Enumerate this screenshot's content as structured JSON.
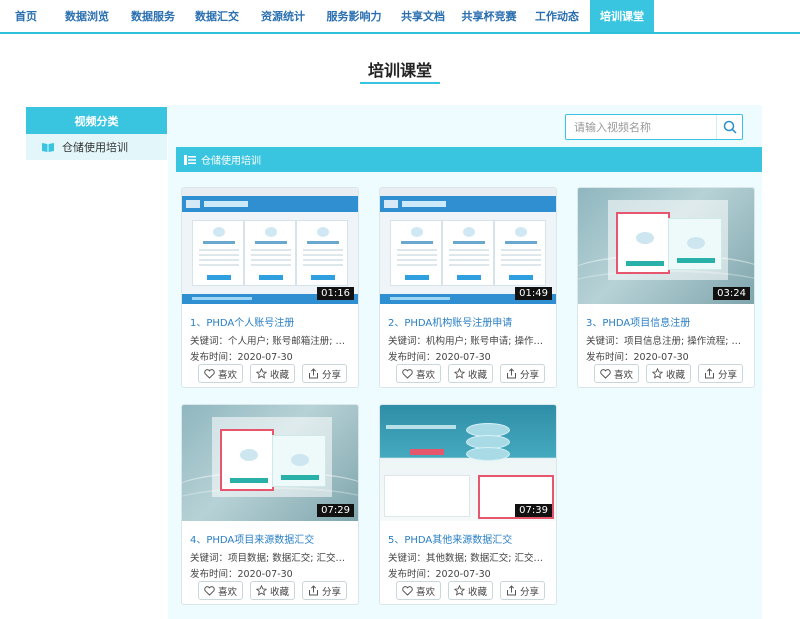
{
  "nav": {
    "items": [
      "首页",
      "数据浏览",
      "数据服务",
      "数据汇交",
      "资源统计",
      "服务影响力",
      "共享文档",
      "共享杯竞赛",
      "工作动态",
      "培训课堂"
    ],
    "active_index": 9
  },
  "page": {
    "title": "培训课堂"
  },
  "sidebar": {
    "heading": "视频分类",
    "items": [
      {
        "label": "仓储使用培训",
        "icon": "book-icon"
      }
    ]
  },
  "search": {
    "placeholder": "请输入视频名称",
    "icon": "search-icon"
  },
  "category": {
    "label": "仓储使用培训",
    "icon": "list-icon"
  },
  "actions": {
    "like": "喜欢",
    "favorite": "收藏",
    "share": "分享"
  },
  "videos": [
    {
      "title": "1、PHDA个人账号注册",
      "keywords": "关键词：个人用户; 账号邮箱注册; 操作...",
      "date": "发布时间：2020-07-30",
      "duration": "01:16",
      "thumb": "web"
    },
    {
      "title": "2、PHDA机构账号注册申请",
      "keywords": "关键词：机构用户; 账号申请; 操作流程; ...",
      "date": "发布时间：2020-07-30",
      "duration": "01:49",
      "thumb": "web"
    },
    {
      "title": "3、PHDA项目信息注册",
      "keywords": "关键词：项目信息注册; 操作流程; 人口...",
      "date": "发布时间：2020-07-30",
      "duration": "03:24",
      "thumb": "ocean"
    },
    {
      "title": "4、PHDA项目来源数据汇交",
      "keywords": "关键词：项目数据; 数据汇交; 汇交流程; ...",
      "date": "发布时间：2020-07-30",
      "duration": "07:29",
      "thumb": "ocean"
    },
    {
      "title": "5、PHDA其他来源数据汇交",
      "keywords": "关键词：其他数据; 数据汇交; 汇交流程; ...",
      "date": "发布时间：2020-07-30",
      "duration": "07:39",
      "thumb": "db"
    }
  ]
}
